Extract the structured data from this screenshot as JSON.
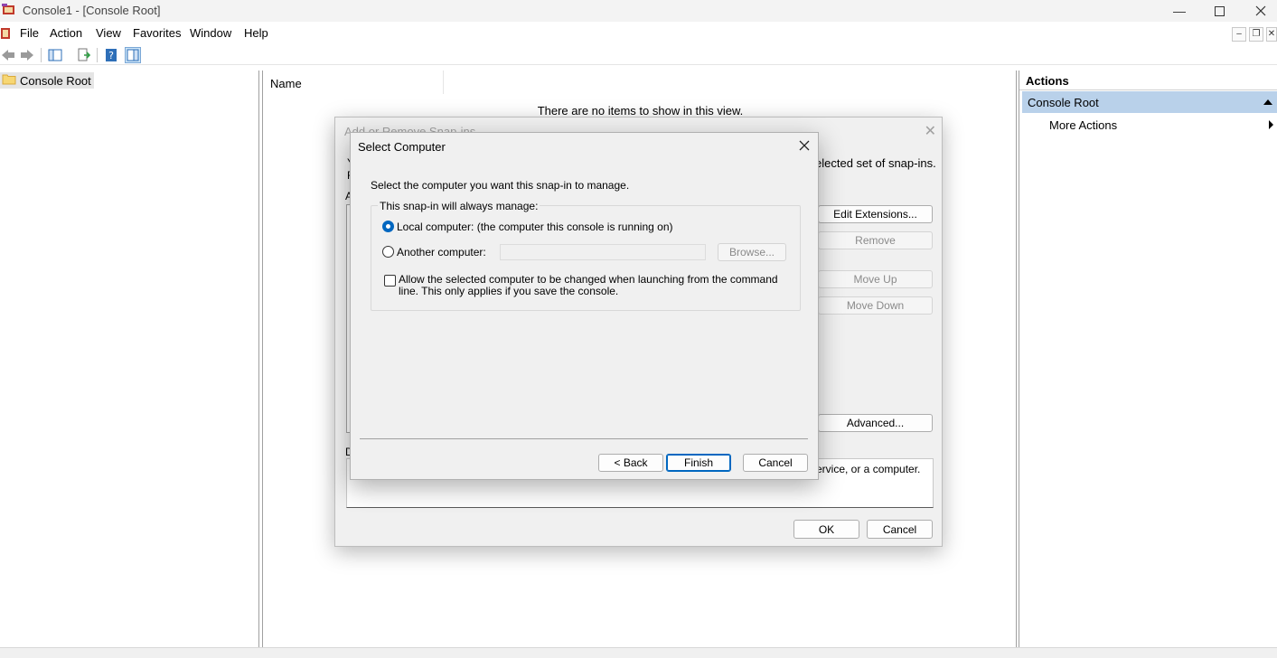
{
  "window": {
    "title": "Console1 - [Console Root]"
  },
  "menu": [
    "File",
    "Action",
    "View",
    "Favorites",
    "Window",
    "Help"
  ],
  "tree": {
    "root_label": "Console Root"
  },
  "content": {
    "column_name": "Name",
    "empty_message": "There are no items to show in this view."
  },
  "actions": {
    "title": "Actions",
    "section": "Console Root",
    "more_actions": "More Actions"
  },
  "bg_dialog": {
    "title": "Add or Remove Snap-ins",
    "desc_tail": "elected set of snap-ins.",
    "frag_y": "Y",
    "frag_f": "F",
    "frag_a": "A",
    "frag_d": "D",
    "buttons": {
      "edit_extensions": "Edit Extensions...",
      "remove": "Remove",
      "move_up": "Move Up",
      "move_down": "Move Down",
      "advanced": "Advanced...",
      "ok": "OK",
      "cancel": "Cancel"
    },
    "desc_box_tail": "ervice, or a computer."
  },
  "fg_dialog": {
    "title": "Select Computer",
    "instruction": "Select the computer you want this snap-in to manage.",
    "group_label": "This snap-in will always manage:",
    "local_label": "Local computer:  (the computer this console is running on)",
    "another_label": "Another computer:",
    "computer_value": "",
    "browse_label": "Browse...",
    "allow_change_label": "Allow the selected computer to be changed when launching from the command line.  This only applies if you save the console.",
    "back_label": "< Back",
    "finish_label": "Finish",
    "cancel_label": "Cancel"
  },
  "colors": {
    "selection": "#b9d1ea",
    "accent": "#0067c0"
  }
}
